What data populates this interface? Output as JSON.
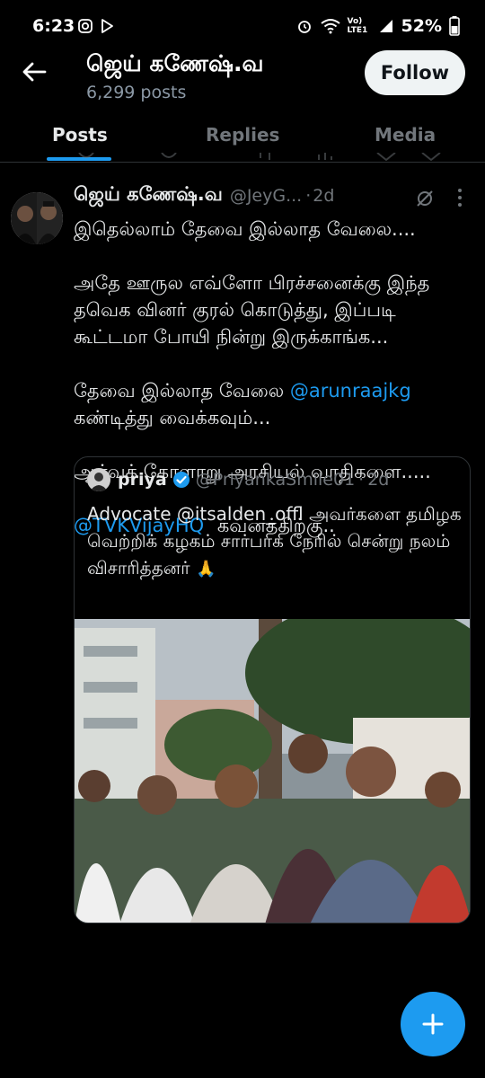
{
  "status_bar": {
    "time": "6:23",
    "battery": "52%",
    "network_label": "Vo) LTE1"
  },
  "header": {
    "name": "ஜெய் கணேஷ்.வ",
    "posts_count": "6,299 posts",
    "follow_label": "Follow"
  },
  "tabs": [
    {
      "label": "Posts",
      "active": true
    },
    {
      "label": "Replies",
      "active": false
    },
    {
      "label": "Media",
      "active": false
    }
  ],
  "post": {
    "author_name": "ஜெய் கணேஷ்.வ",
    "handle": "@JeyG...",
    "dot": "·",
    "time": "2d",
    "paragraphs": [
      "இதெல்லாம் தேவை இல்லாத வேலை....",
      "அதே ஊருல எவ்ளோ பிரச்சனைக்கு இந்த தவெக வினர் குரல் கொடுத்து, இப்படி கூட்டமா போயி நின்று இருக்காங்க...",
      "தேவை இல்லாத வேலை",
      "கண்டித்து வைக்கவும்...",
      "ஆர்வக் கோளாறு அரசியல் வாதிகளை.....",
      "கவனத்திற்கு.."
    ],
    "mention_1": "@arunraajkg",
    "mention_2": "@TVKVijayHQ"
  },
  "quote": {
    "name": "priya",
    "handle": "@PriyankaSmile01",
    "dot": "·",
    "time": "2d",
    "text_prefix": "Advocate",
    "mention": "@itsalden_offl",
    "text_rest": "அவர்களை தமிழக வெற்றிக் கழகம் சார்பாக நேரில் சென்று நலம் விசாரித்தனர்",
    "emoji": "🙏"
  },
  "colors": {
    "accent": "#1d9bf0",
    "background": "#000000",
    "muted": "#71767b"
  },
  "icons": [
    "back-arrow-icon",
    "grok-icon",
    "more-icon",
    "verified-icon",
    "plus-icon"
  ]
}
